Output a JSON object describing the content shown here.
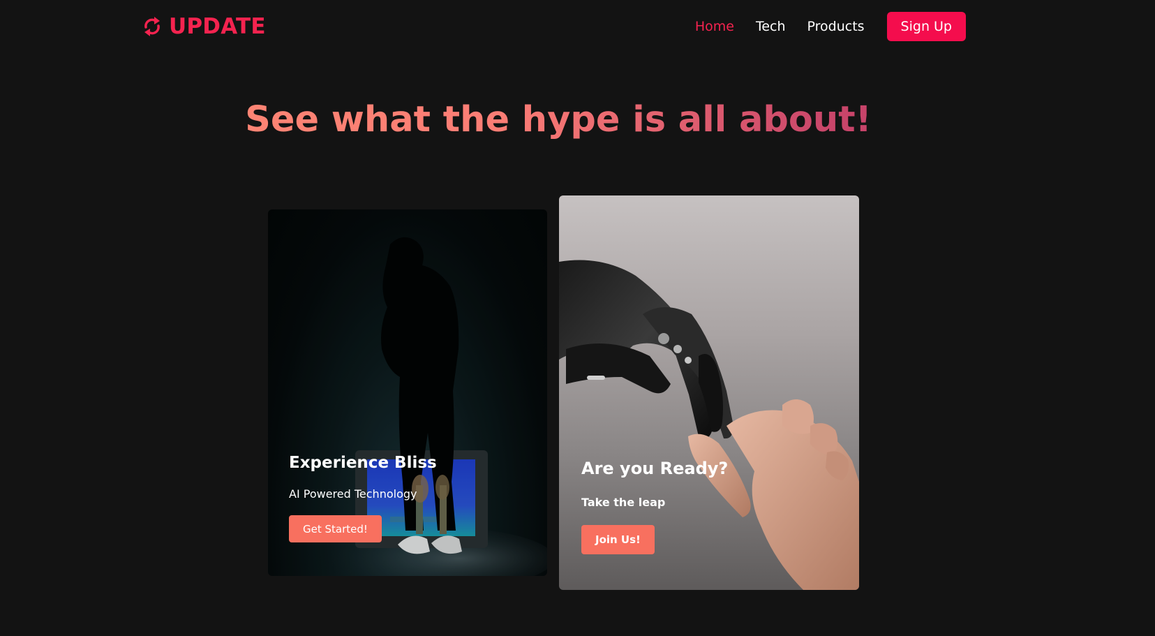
{
  "nav": {
    "logo_text": "UPDATE",
    "logo_icon": "refresh-icon",
    "links": [
      "Home",
      "Tech",
      "Products"
    ],
    "active_link": "Home",
    "signup_label": "Sign Up"
  },
  "hero": {
    "title": "See what the hype is all about!"
  },
  "cards": [
    {
      "title": "Experience Bliss",
      "subtitle": "AI Powered Technology",
      "button_label": "Get Started!",
      "image": "silhouette-person-photo"
    },
    {
      "title": "Are you Ready?",
      "subtitle": "Take the leap",
      "button_label": "Join Us!",
      "image": "robot-human-hands-photo"
    }
  ],
  "colors": {
    "background": "#131313",
    "brand": "#f4234f",
    "signup_button": "#f40d4d",
    "card_button": "#f8705f",
    "headline_start": "#ff8b73",
    "headline_end": "#c03a65"
  }
}
